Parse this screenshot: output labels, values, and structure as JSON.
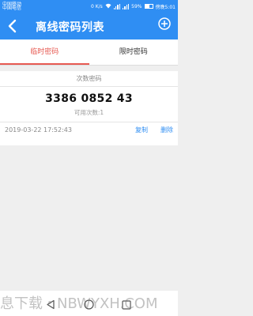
{
  "status": {
    "carrier_line1": "中国移动",
    "carrier_line2": "中国电信",
    "speed": "0 K/s",
    "battery": "59%",
    "time": "傍晚5:01",
    "battery_level": 0.59
  },
  "header": {
    "title": "离线密码列表"
  },
  "tabs": [
    {
      "label": "临时密码",
      "active": true
    },
    {
      "label": "限时密码",
      "active": false
    }
  ],
  "password": {
    "type": "次数密码",
    "code": "3386 0852 43",
    "uses": "可用次数:1",
    "datetime": "2019-03-22 17:52:43",
    "copy_label": "复制",
    "delete_label": "删除"
  },
  "watermark": "息下载・NBWYXH.COM",
  "colors": {
    "primary": "#2f8ef3",
    "tab_active": "#e75a52"
  }
}
